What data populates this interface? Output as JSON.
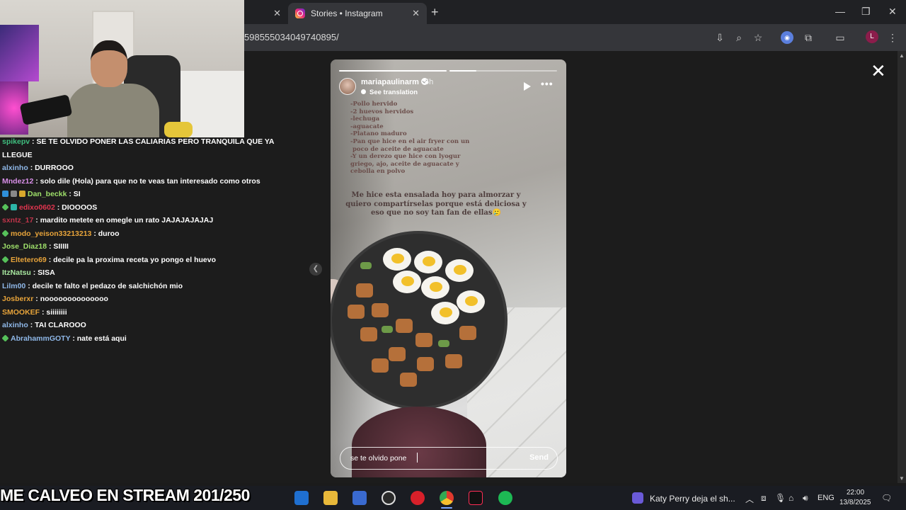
{
  "browser": {
    "tabs": [
      {
        "title": "",
        "active": false
      },
      {
        "title": "Stories • Instagram",
        "active": true
      }
    ],
    "url_fragment": "598555034049740895/",
    "profile_initial": "L"
  },
  "chat": {
    "messages": [
      {
        "user": "spikepv",
        "text": ": SE TE OLVIDO PONER LAS CALIARIAS PERO TRANQUILA QUE YA",
        "color": "#3fbf7f",
        "badges": []
      },
      {
        "user": "",
        "text": "LLEGUE",
        "color": "#ffffff",
        "badges": []
      },
      {
        "user": "alxinho",
        "text": ": DURROOO",
        "color": "#8fb8e8",
        "badges": []
      },
      {
        "user": "Mndez12",
        "text": ": solo dile (Hola) para que no te veas tan interesado como otros",
        "color": "#d88fe8",
        "badges": []
      },
      {
        "user": "Dan_beckk",
        "text": ": SI",
        "color": "#9ee06a",
        "badges": [
          "blue",
          "gray",
          "gold"
        ]
      },
      {
        "user": "edixo0602",
        "text": ": DIOOOOS",
        "color": "#e0354f",
        "badges": [
          "green",
          "teal"
        ]
      },
      {
        "user": "sxntz_17",
        "text": ": mardito metete en omegle un rato JAJAJAJAJAJ",
        "color": "#c0344a",
        "badges": []
      },
      {
        "user": "modo_yeison33213213",
        "text": ": duroo",
        "color": "#e8a43a",
        "badges": [
          "green"
        ]
      },
      {
        "user": "Jose_Diaz18",
        "text": ": SIIIII",
        "color": "#9ee06a",
        "badges": []
      },
      {
        "user": "Eltetero69",
        "text": ": decile pa la proxima receta yo pongo el huevo",
        "color": "#e8a43a",
        "badges": [
          "green"
        ]
      },
      {
        "user": "ItzNatsu",
        "text": ": SISA",
        "color": "#a8e8a0",
        "badges": []
      },
      {
        "user": "Lilm00",
        "text": ": decile te falto el pedazo de salchichón mio",
        "color": "#8fb8e8",
        "badges": []
      },
      {
        "user": "Josberxr",
        "text": ": noooooooooooooo",
        "color": "#e8a43a",
        "badges": []
      },
      {
        "user": "SMOOKEF",
        "text": ": siiiiiiii",
        "color": "#e8a43a",
        "badges": []
      },
      {
        "user": "alxinho",
        "text": ": TAI CLAROOO",
        "color": "#8fb8e8",
        "badges": []
      },
      {
        "user": "AbrahammGOTY",
        "text": ": nate está aqui",
        "color": "#8fb8e8",
        "badges": [
          "green"
        ]
      }
    ]
  },
  "story": {
    "username": "mariapaulinarm",
    "time": "5h",
    "translation_label": "See translation",
    "progress_segments": [
      1,
      0.25,
      0
    ],
    "ingredients": [
      "-Pollo hervido",
      "-2 huevos hervidos",
      "-lechuga",
      "-aguacate",
      "-Platano maduro",
      "-Pan que hice en el air fryer con un",
      " poco de aceite de aguacate",
      "-Y un derezo que hice con lyogur",
      "griego, ajo, aceite de aguacate y",
      "cebolla en polvo"
    ],
    "caption": "Me hice esta ensalada hoy para almorzar y quiero compartírselas porque está deliciosa y eso que no soy tan fan de ellas🥲",
    "reply_text": "se te olvido pone",
    "send_label": "Send"
  },
  "banner": "ME CALVEO EN STREAM 201/250",
  "taskbar": {
    "media_title": "Katy Perry deja el sh...",
    "lang": "ENG",
    "time": "22:00",
    "date": "13/8/2025"
  }
}
